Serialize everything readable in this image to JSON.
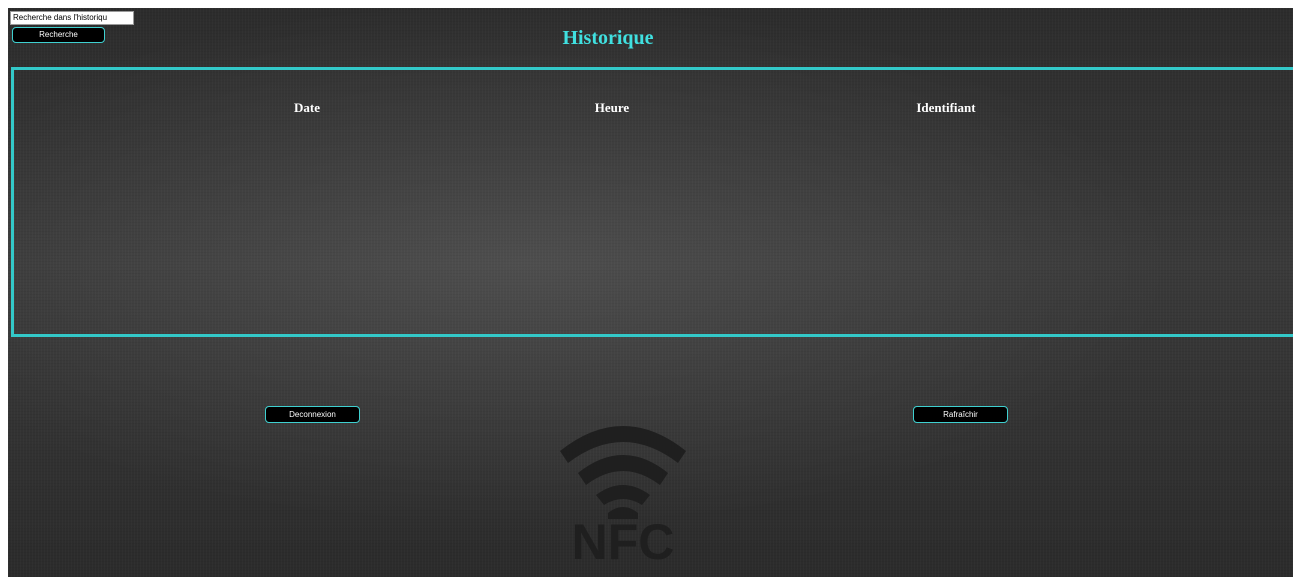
{
  "search": {
    "placeholder": "Recherche dans l'historique",
    "value": "Recherche dans l'historiqu",
    "button_label": "Recherche"
  },
  "header": {
    "title": "Historique"
  },
  "table": {
    "columns": [
      "Date",
      "Heure",
      "Identifiant"
    ],
    "rows": []
  },
  "actions": {
    "logout_label": "Deconnexion",
    "refresh_label": "Rafraîchir"
  },
  "logo": {
    "text": "NFC",
    "icon": "nfc-wifi-icon"
  },
  "colors": {
    "accent": "#40e0e0",
    "frame": "#33c8c8",
    "background": "#333333",
    "button_bg": "#000000"
  }
}
